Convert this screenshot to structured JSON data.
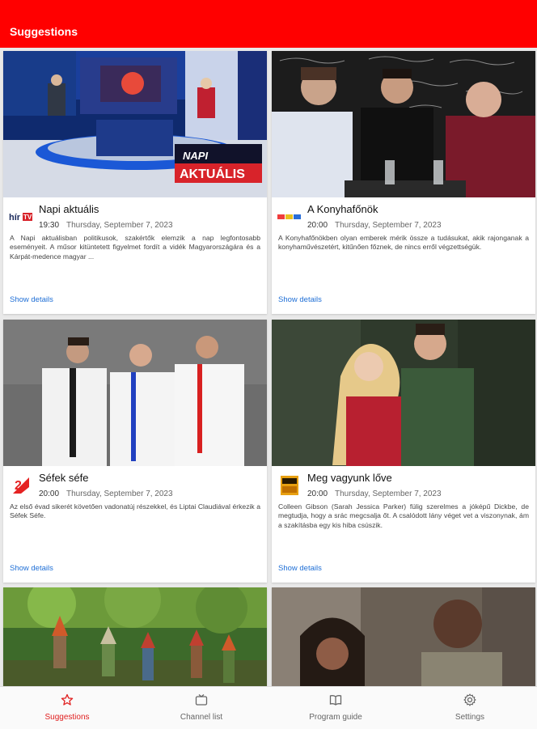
{
  "appbar": {
    "title": "Suggestions",
    "color": "#ff0000"
  },
  "cards": [
    {
      "title": "Napi aktuális",
      "channel": "hírTV",
      "channel_logo_icon": "hirtv-logo-icon",
      "time": "19:30",
      "date": "Thursday, September 7, 2023",
      "description": "A Napi aktuálisban politikusok, szakértők elemzik a nap legfontosabb eseményeit. A műsor kitüntetett figyelmet fordít a vidék Magyarországára és a Kárpát-medence magyar ...",
      "thumbnail_overlay_line1": "NAPI",
      "thumbnail_overlay_line2": "AKTUÁLIS",
      "details_label": "Show details"
    },
    {
      "title": "A Konyhafőnök",
      "channel": "RTL",
      "channel_logo_icon": "rtl-logo-icon",
      "time": "20:00",
      "date": "Thursday, September 7, 2023",
      "description": "A Konyhafőnökben olyan emberek mérik össze a tudásukat, akik rajonganak a konyhaművészetért, kitűnően főznek, de nincs erről végzettségük.",
      "details_label": "Show details"
    },
    {
      "title": "Séfek séfe",
      "channel": "TV2",
      "channel_logo_icon": "tv2-logo-icon",
      "time": "20:00",
      "date": "Thursday, September 7, 2023",
      "description": "Az első évad sikerét követően vadonatúj részekkel, és Liptai Claudiával érkezik a Séfek Séfe.",
      "details_label": "Show details"
    },
    {
      "title": "Meg vagyunk lőve",
      "channel": "Sony Max",
      "channel_logo_icon": "sony-max-logo-icon",
      "time": "20:00",
      "date": "Thursday, September 7, 2023",
      "description": "Colleen Gibson (Sarah Jessica Parker) fülig szerelmes a jóképű Dickbe, de megtudja, hogy a srác megcsalja őt. A csalódott lány véget vet a viszonynak, ám a szakításba egy kis hiba csúszik.",
      "details_label": "Show details"
    }
  ],
  "bottom_nav": [
    {
      "label": "Suggestions",
      "icon": "star-icon",
      "active": true
    },
    {
      "label": "Channel list",
      "icon": "tv-icon",
      "active": false
    },
    {
      "label": "Program guide",
      "icon": "book-icon",
      "active": false
    },
    {
      "label": "Settings",
      "icon": "gear-icon",
      "active": false
    }
  ],
  "colors": {
    "accent": "#ff0000",
    "active_nav": "#e02020",
    "link": "#1f6fd6"
  }
}
